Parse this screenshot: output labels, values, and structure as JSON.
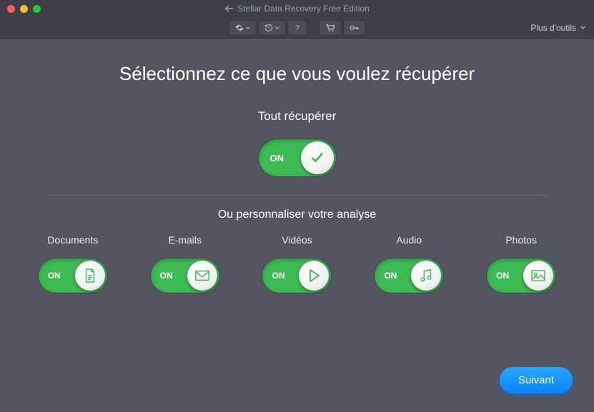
{
  "window": {
    "title": "Stellar Data Recovery Free Edition"
  },
  "toolbar": {
    "more_tools": "Plus d'outils"
  },
  "heading": "Sélectionnez ce que vous voulez récupérer",
  "recover_all": {
    "title": "Tout récupérer",
    "state_label": "ON",
    "on": true
  },
  "customize_title": "Ou personnaliser votre analyse",
  "categories": [
    {
      "label": "Documents",
      "state_label": "ON",
      "on": true,
      "icon": "document"
    },
    {
      "label": "E-mails",
      "state_label": "ON",
      "on": true,
      "icon": "mail"
    },
    {
      "label": "Vidéos",
      "state_label": "ON",
      "on": true,
      "icon": "play"
    },
    {
      "label": "Audio",
      "state_label": "ON",
      "on": true,
      "icon": "music"
    },
    {
      "label": "Photos",
      "state_label": "ON",
      "on": true,
      "icon": "image"
    }
  ],
  "next_button": "Suivant",
  "colors": {
    "toggle_on": "#3dbb54",
    "accent": "#0a84ff",
    "background": "#545560"
  }
}
